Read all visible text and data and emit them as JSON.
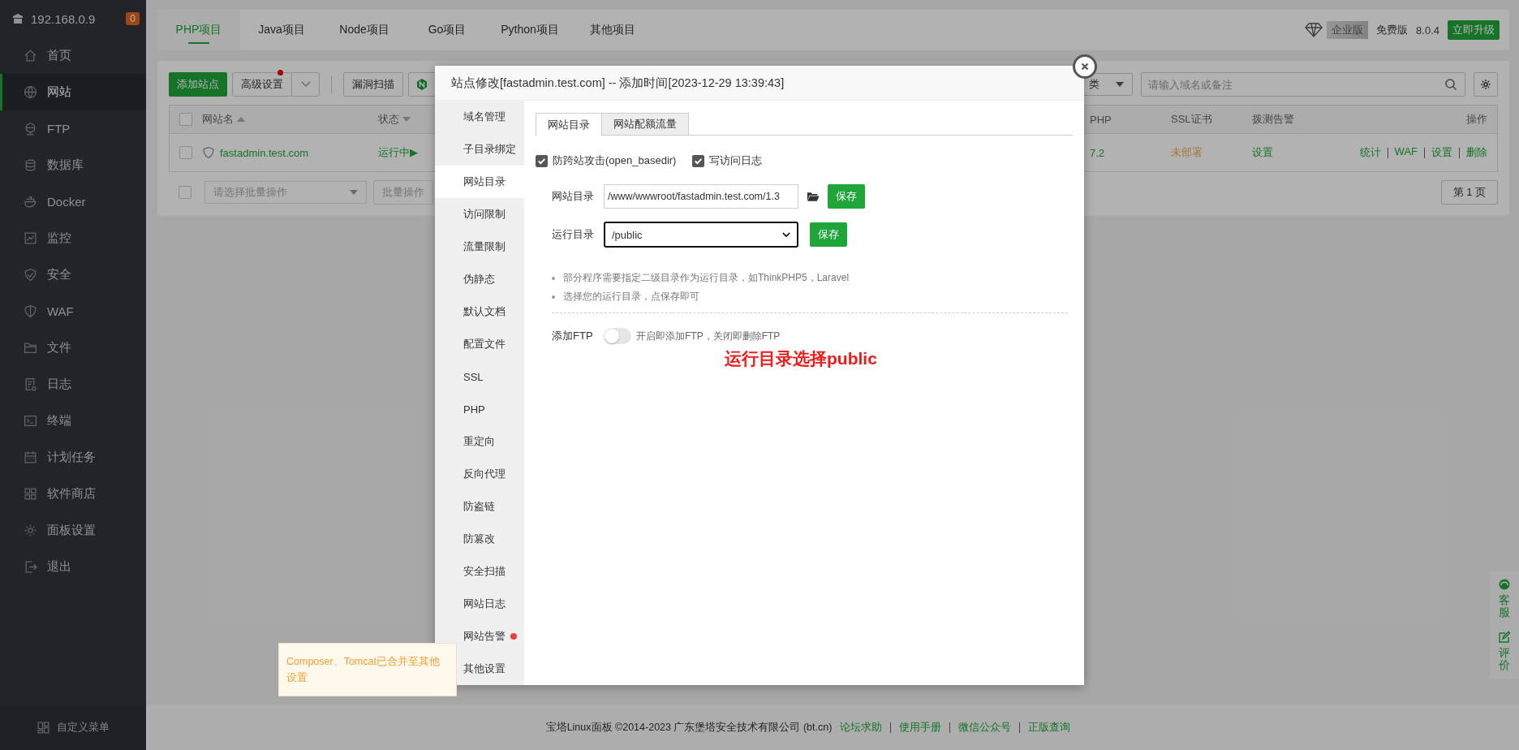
{
  "sidebar": {
    "host": "192.168.0.9",
    "badge": "0",
    "items": [
      {
        "label": "首页",
        "selected": false
      },
      {
        "label": "网站",
        "selected": true
      },
      {
        "label": "FTP",
        "selected": false
      },
      {
        "label": "数据库",
        "selected": false
      },
      {
        "label": "Docker",
        "selected": false
      },
      {
        "label": "监控",
        "selected": false
      },
      {
        "label": "安全",
        "selected": false
      },
      {
        "label": "WAF",
        "selected": false
      },
      {
        "label": "文件",
        "selected": false
      },
      {
        "label": "日志",
        "selected": false
      },
      {
        "label": "终端",
        "selected": false
      },
      {
        "label": "计划任务",
        "selected": false
      },
      {
        "label": "软件商店",
        "selected": false
      },
      {
        "label": "面板设置",
        "selected": false
      },
      {
        "label": "退出",
        "selected": false
      }
    ],
    "custom_menu": "自定义菜单"
  },
  "project_tabs": [
    {
      "label": "PHP项目",
      "selected": true
    },
    {
      "label": "Java项目",
      "selected": false
    },
    {
      "label": "Node项目",
      "selected": false
    },
    {
      "label": "Go项目",
      "selected": false
    },
    {
      "label": "Python项目",
      "selected": false
    },
    {
      "label": "其他项目",
      "selected": false
    }
  ],
  "edition": {
    "enterprise": "企业版",
    "free": "免费版",
    "version": "8.0.4",
    "upgrade": "立即升级"
  },
  "toolbar": {
    "add_site": "添加站点",
    "advanced": "高级设置",
    "scan": "漏洞扫描",
    "category": "类",
    "search_placeholder": "请输入域名或备注"
  },
  "table": {
    "select_all": false,
    "columns": [
      "网站名",
      "状态",
      "PHP",
      "SSL证书",
      "拨测告警",
      "操作"
    ],
    "rows": [
      {
        "checked": false,
        "name": "fastadmin.test.com",
        "status": "运行中▶",
        "php": "7.2",
        "ssl": "未部署",
        "monitor": "设置",
        "actions": [
          "统计",
          "WAF",
          "设置",
          "删除"
        ]
      }
    ]
  },
  "batch": {
    "checked": false,
    "placeholder": "请选择批量操作",
    "button": "批量操作",
    "page": "第 1 页"
  },
  "modal": {
    "title": "站点修改[fastadmin.test.com] -- 添加时间[2023-12-29 13:39:43]",
    "menu": [
      {
        "label": "域名管理",
        "selected": false,
        "alert": false
      },
      {
        "label": "子目录绑定",
        "selected": false,
        "alert": false
      },
      {
        "label": "网站目录",
        "selected": true,
        "alert": false
      },
      {
        "label": "访问限制",
        "selected": false,
        "alert": false
      },
      {
        "label": "流量限制",
        "selected": false,
        "alert": false
      },
      {
        "label": "伪静态",
        "selected": false,
        "alert": false
      },
      {
        "label": "默认文档",
        "selected": false,
        "alert": false
      },
      {
        "label": "配置文件",
        "selected": false,
        "alert": false
      },
      {
        "label": "SSL",
        "selected": false,
        "alert": false
      },
      {
        "label": "PHP",
        "selected": false,
        "alert": false
      },
      {
        "label": "重定向",
        "selected": false,
        "alert": false
      },
      {
        "label": "反向代理",
        "selected": false,
        "alert": false
      },
      {
        "label": "防盗链",
        "selected": false,
        "alert": false
      },
      {
        "label": "防篡改",
        "selected": false,
        "alert": false
      },
      {
        "label": "安全扫描",
        "selected": false,
        "alert": false
      },
      {
        "label": "网站日志",
        "selected": false,
        "alert": false
      },
      {
        "label": "网站告警",
        "selected": false,
        "alert": true
      },
      {
        "label": "其他设置",
        "selected": false,
        "alert": false
      }
    ],
    "tabs": [
      {
        "label": "网站目录",
        "selected": true
      },
      {
        "label": "网站配额流量",
        "selected": false
      }
    ],
    "options": [
      {
        "label": "防跨站攻击(open_basedir)",
        "checked": true
      },
      {
        "label": "写访问日志",
        "checked": true
      }
    ],
    "site_dir": {
      "label": "网站目录",
      "value": "/www/wwwroot/fastadmin.test.com/1.3",
      "save": "保存"
    },
    "run_dir": {
      "label": "运行目录",
      "value": "/public",
      "save": "保存"
    },
    "notes": [
      "部分程序需要指定二级目录作为运行目录，如ThinkPHP5，Laravel",
      "选择您的运行目录，点保存即可"
    ],
    "ftp": {
      "label": "添加FTP",
      "on": false,
      "hint": "开启即添加FTP，关闭即删除FTP"
    },
    "annotation": "运行目录选择public"
  },
  "tooltip": "Composer、Tomcat已合并至其他设置",
  "float_buttons": [
    {
      "label": "客服"
    },
    {
      "label": "评价"
    }
  ],
  "footer": {
    "copyright": "宝塔Linux面板 ©2014-2023 广东堡塔安全技术有限公司 (bt.cn)",
    "links": [
      "论坛求助",
      "使用手册",
      "微信公众号",
      "正版查询"
    ]
  }
}
